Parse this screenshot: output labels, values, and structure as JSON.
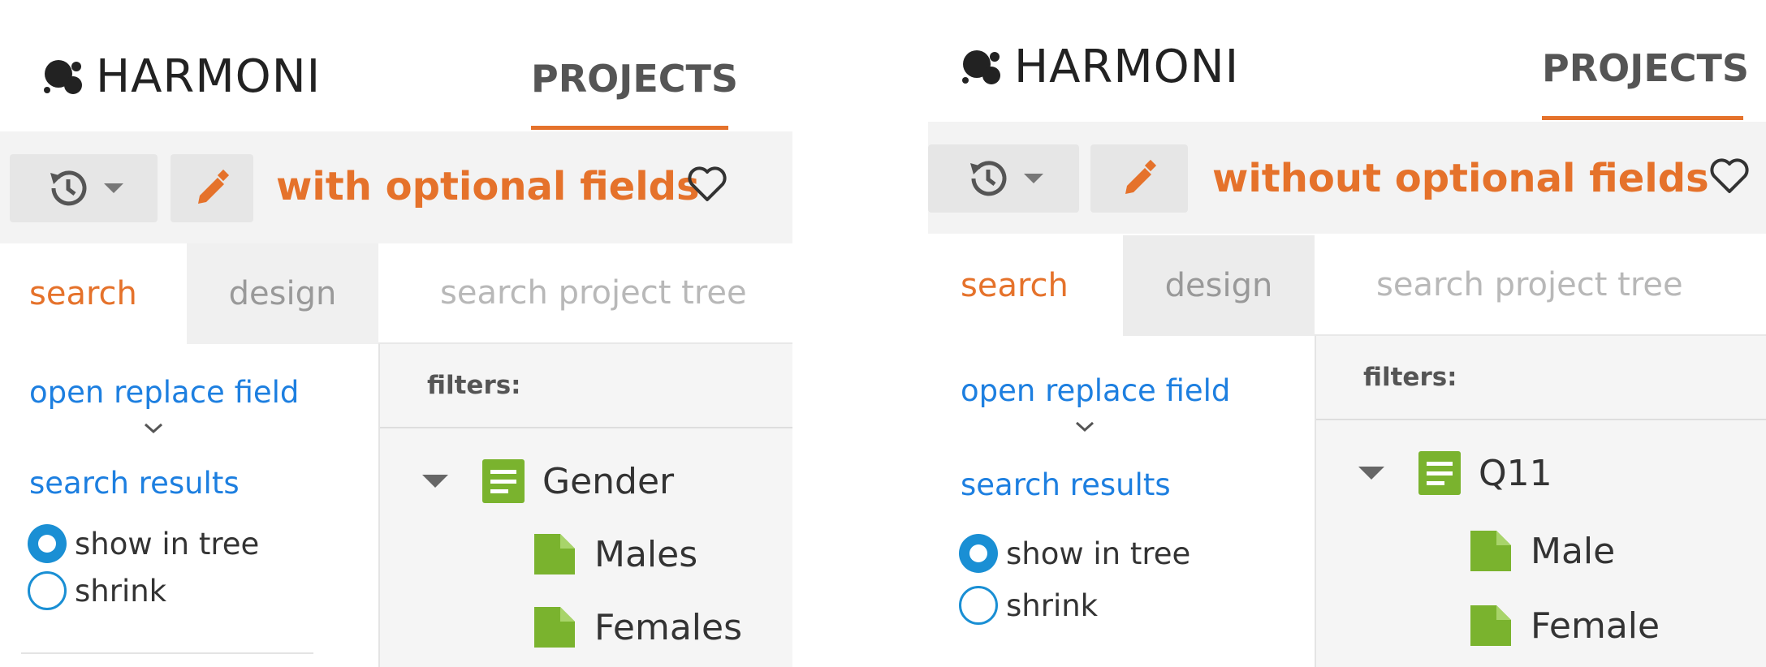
{
  "brand": {
    "logo_text": "HARMONI"
  },
  "colors": {
    "accent": "#e5722b",
    "link": "#1d7fe0",
    "radio": "#1a8fd4",
    "leaf_icon": "#7ab32e",
    "toolbar_bg": "#f3f3f3"
  },
  "panels": [
    {
      "nav_tab": "PROJECTS",
      "project_title": "with optional fields",
      "tabs": {
        "search": "search",
        "design": "design"
      },
      "tree_search_placeholder": "search project tree",
      "open_replace_field": "open replace field",
      "search_results": "search results",
      "radio_options": [
        {
          "label": "show in tree",
          "checked": true
        },
        {
          "label": "shrink",
          "checked": false
        }
      ],
      "filters_label": "filters:",
      "tree": {
        "parent": "Gender",
        "children": [
          "Males",
          "Females"
        ]
      },
      "icons": {
        "history": "history-icon",
        "edit": "pencil-icon",
        "favorite": "heart-icon",
        "folder": "question-icon",
        "leaf": "code-icon"
      }
    },
    {
      "nav_tab": "PROJECTS",
      "project_title": "without optional fields",
      "tabs": {
        "search": "search",
        "design": "design"
      },
      "tree_search_placeholder": "search project tree",
      "open_replace_field": "open replace field",
      "search_results": "search results",
      "radio_options": [
        {
          "label": "show in tree",
          "checked": true
        },
        {
          "label": "shrink",
          "checked": false
        }
      ],
      "filters_label": "filters:",
      "tree": {
        "parent": "Q11",
        "children": [
          "Male",
          "Female"
        ]
      },
      "icons": {
        "history": "history-icon",
        "edit": "pencil-icon",
        "favorite": "heart-icon",
        "folder": "question-icon",
        "leaf": "code-icon"
      }
    }
  ]
}
